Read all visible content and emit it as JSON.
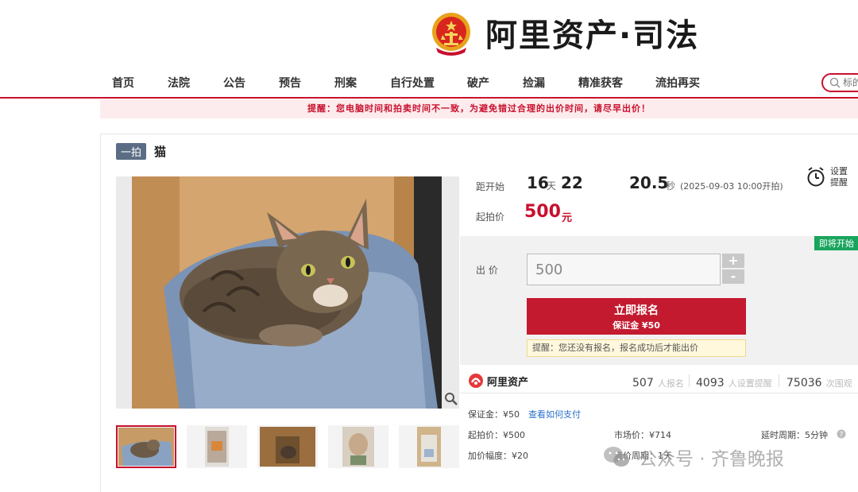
{
  "header": {
    "logo_text": "阿里资产·司法"
  },
  "nav": {
    "items": [
      "首页",
      "法院",
      "公告",
      "预告",
      "刑案",
      "自行处置",
      "破产",
      "捡漏",
      "精准获客",
      "流拍再买"
    ],
    "search_placeholder": "标的"
  },
  "alert": {
    "text": "提醒：您电脑时间和拍卖时间不一致，为避免错过合理的出价时间，请尽早出价！"
  },
  "item": {
    "badge": "一拍",
    "title": "猫"
  },
  "countdown": {
    "label": "距开始",
    "days": "16",
    "days_unit": "天",
    "hours": "22",
    "seconds": "20.5",
    "seconds_unit": "秒",
    "start_time": "(2025-09-03 10:00开拍)"
  },
  "start_price": {
    "label": "起拍价",
    "value": "500",
    "unit": "元"
  },
  "remind": {
    "label": "设置提醒"
  },
  "bid": {
    "status_badge": "即将开始",
    "label": "出 价",
    "input_value": "500",
    "plus": "+",
    "minus": "-",
    "signup_label": "立即报名",
    "deposit_label": "保证金 ¥50",
    "tip": "提醒：您还没有报名，报名成功后才能出价"
  },
  "stats": {
    "logo_text": "阿里资产",
    "signups_count": "507",
    "signups_label": "人报名",
    "reminders_count": "4093",
    "reminders_label": "人设置提醒",
    "views_count": "75036",
    "views_label": "次围观"
  },
  "details": {
    "deposit": "保证金：¥50",
    "how_to_pay": "查看如何支付",
    "start_price": "起拍价：¥500",
    "market_price": "市场价：¥714",
    "delay_period": "延时周期：5分钟",
    "increment": "加价幅度：¥20",
    "bid_period": "竞价周期：1天"
  },
  "watermark": {
    "text": "公众号 · 齐鲁晚报"
  },
  "colors": {
    "brand_red": "#c8102e",
    "status_green": "#19a55e",
    "badge_gray": "#5b6d84"
  }
}
